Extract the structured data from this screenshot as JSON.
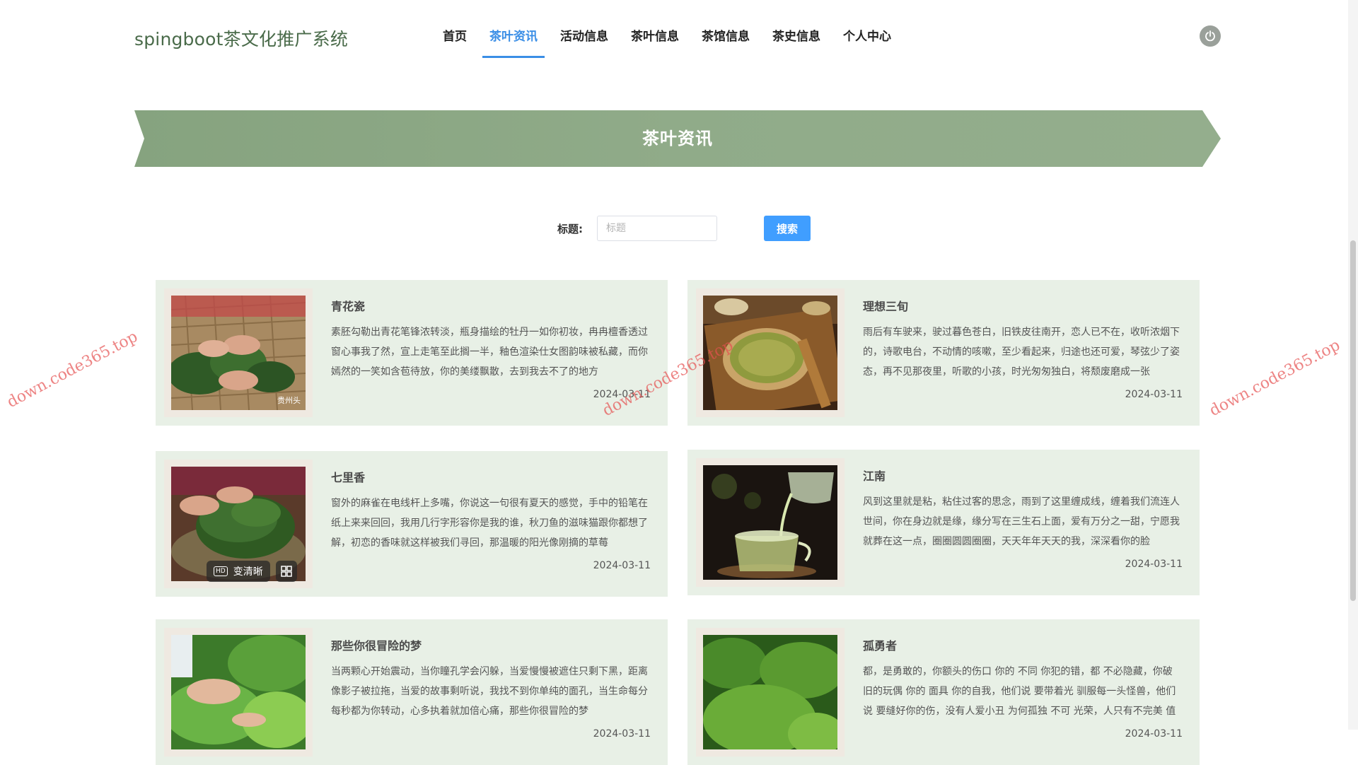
{
  "header": {
    "brand": "spingboot茶文化推广系统",
    "nav": [
      {
        "label": "首页",
        "active": false
      },
      {
        "label": "茶叶资讯",
        "active": true
      },
      {
        "label": "活动信息",
        "active": false
      },
      {
        "label": "茶叶信息",
        "active": false
      },
      {
        "label": "茶馆信息",
        "active": false
      },
      {
        "label": "茶史信息",
        "active": false
      },
      {
        "label": "个人中心",
        "active": false
      }
    ],
    "power_icon": "power-icon"
  },
  "banner": {
    "title": "茶叶资讯",
    "color": "#8fa987"
  },
  "search": {
    "label": "标题:",
    "placeholder": "标题",
    "value": "",
    "button_label": "搜索"
  },
  "news": [
    {
      "title": "青花瓷",
      "desc": "素胚勾勒出青花笔锋浓转淡，瓶身描绘的牡丹一如你初妆，冉冉檀香透过窗心事我了然，宣上走笔至此搁一半，釉色渲染仕女图韵味被私藏，而你嫣然的一笑如含苞待放，你的美缕飘散，去到我去不了的地方",
      "date": "2024-03-11",
      "image_watermark": "贵州头"
    },
    {
      "title": "理想三旬",
      "desc": "雨后有车驶来，驶过暮色苍白，旧铁皮往南开，恋人已不在，收听浓烟下的，诗歌电台，不动情的咳嗽，至少看起来，归途也还可爱，琴弦少了姿态，再不见那夜里，听歌的小孩，时光匆匆独白，将颓废磨成一张",
      "date": "2024-03-11"
    },
    {
      "title": "七里香",
      "desc": "窗外的麻雀在电线杆上多嘴，你说这一句很有夏天的感觉，手中的铅笔在纸上来来回回，我用几行字形容你是我的谁，秋刀鱼的滋味猫跟你都想了解，初恋的香味就这样被我们寻回，那温暖的阳光像刚摘的草莓",
      "date": "2024-03-11",
      "overlay_label": "变清晰",
      "overlay_badge": "HD"
    },
    {
      "title": "江南",
      "desc": "风到这里就是粘，粘住过客的思念，雨到了这里缠成线，缠着我们流连人世间，你在身边就是缘，缘分写在三生石上面，爱有万分之一甜，宁愿我就葬在这一点，圈圈圆圆圈圈，天天年年天天的我，深深看你的脸",
      "date": "2024-03-11"
    },
    {
      "title": "那些你很冒险的梦",
      "desc": "当两颗心开始震动，当你瞳孔学会闪躲，当爱慢慢被遮住只剩下黑，距离像影子被拉拖，当爱的故事剩听说，我找不到你单纯的面孔，当生命每分每秒都为你转动，心多执着就加倍心痛，那些你很冒险的梦",
      "date": "2024-03-11"
    },
    {
      "title": "孤勇者",
      "desc": "都，是勇敢的，你额头的伤口 你的 不同 你犯的错，都 不必隐藏，你破旧的玩偶 你的 面具 你的自我，他们说 要带着光 驯服每一头怪兽，他们说 要缝好你的伤，没有人爱小丑 为何孤独 不可 光荣，人只有不完美 值得歌颂",
      "date": "2024-03-11"
    }
  ],
  "watermark_text": "down.code365.top"
}
